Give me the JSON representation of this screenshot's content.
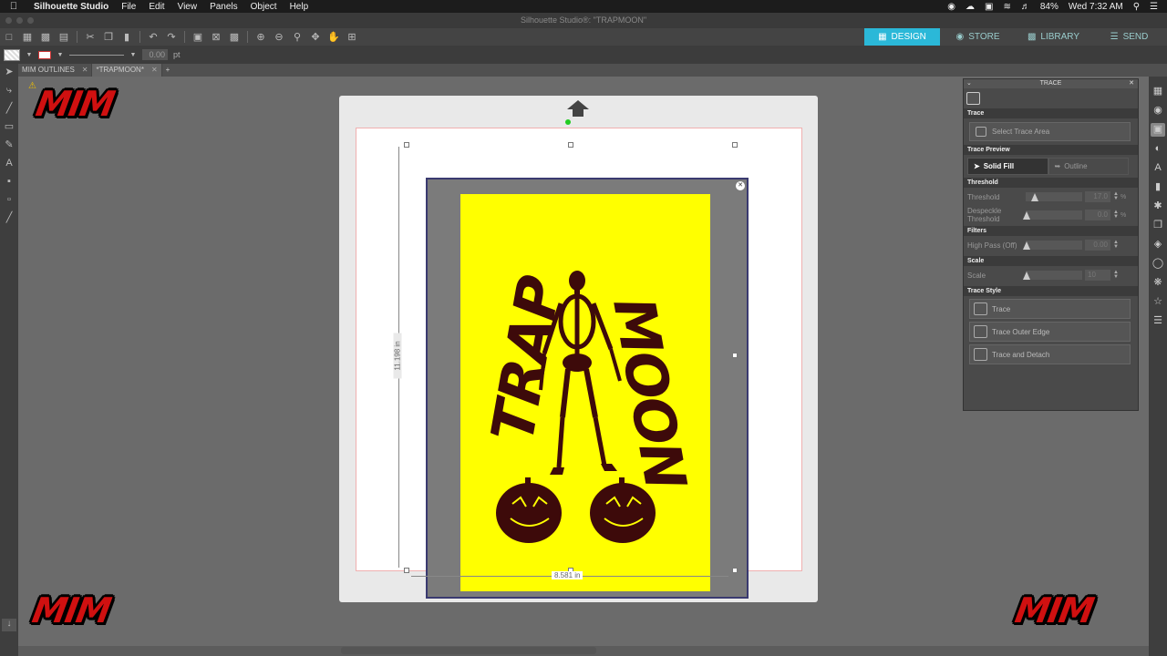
{
  "menubar": {
    "app_name": "Silhouette Studio",
    "menus": [
      "File",
      "Edit",
      "View",
      "Panels",
      "Object",
      "Help"
    ],
    "battery": "84%",
    "clock": "Wed 7:32 AM"
  },
  "window": {
    "title": "Silhouette Studio®: \"TRAPMOON\""
  },
  "modes": {
    "design": "DESIGN",
    "store": "STORE",
    "library": "LIBRARY",
    "send": "SEND"
  },
  "toolbar2": {
    "stroke_width": "0.00",
    "unit": "pt"
  },
  "tabs": [
    {
      "label": "MIM OUTLINES"
    },
    {
      "label": "*TRAPMOON*"
    }
  ],
  "canvas": {
    "height_label": "11.198 in",
    "width_label": "8.581 in",
    "artwork": {
      "left_text": "TRAP",
      "right_text": "MOON"
    }
  },
  "logos": {
    "text": "MIM"
  },
  "trace_panel": {
    "title": "TRACE",
    "trace_section": "Trace",
    "select_area": "Select Trace Area",
    "preview_section": "Trace Preview",
    "solid_fill": "Solid Fill",
    "outline": "Outline",
    "threshold_section": "Threshold",
    "threshold_label": "Threshold",
    "threshold_value": "17.0",
    "threshold_unit": "%",
    "despeckle_label_1": "Despeckle",
    "despeckle_label_2": "Threshold",
    "despeckle_value": "0.0",
    "despeckle_unit": "%",
    "filters_section": "Filters",
    "highpass_label": "High Pass (Off)",
    "highpass_value": "0.00",
    "scale_section": "Scale",
    "scale_label": "Scale",
    "scale_value": "10",
    "style_section": "Trace Style",
    "style_trace": "Trace",
    "style_outer": "Trace Outer Edge",
    "style_detach": "Trace and Detach"
  },
  "colors": {
    "accent": "#2bb8d8",
    "art_background": "#ffff00",
    "art_ink": "#3d0a0a",
    "logo_red": "#d01010"
  }
}
